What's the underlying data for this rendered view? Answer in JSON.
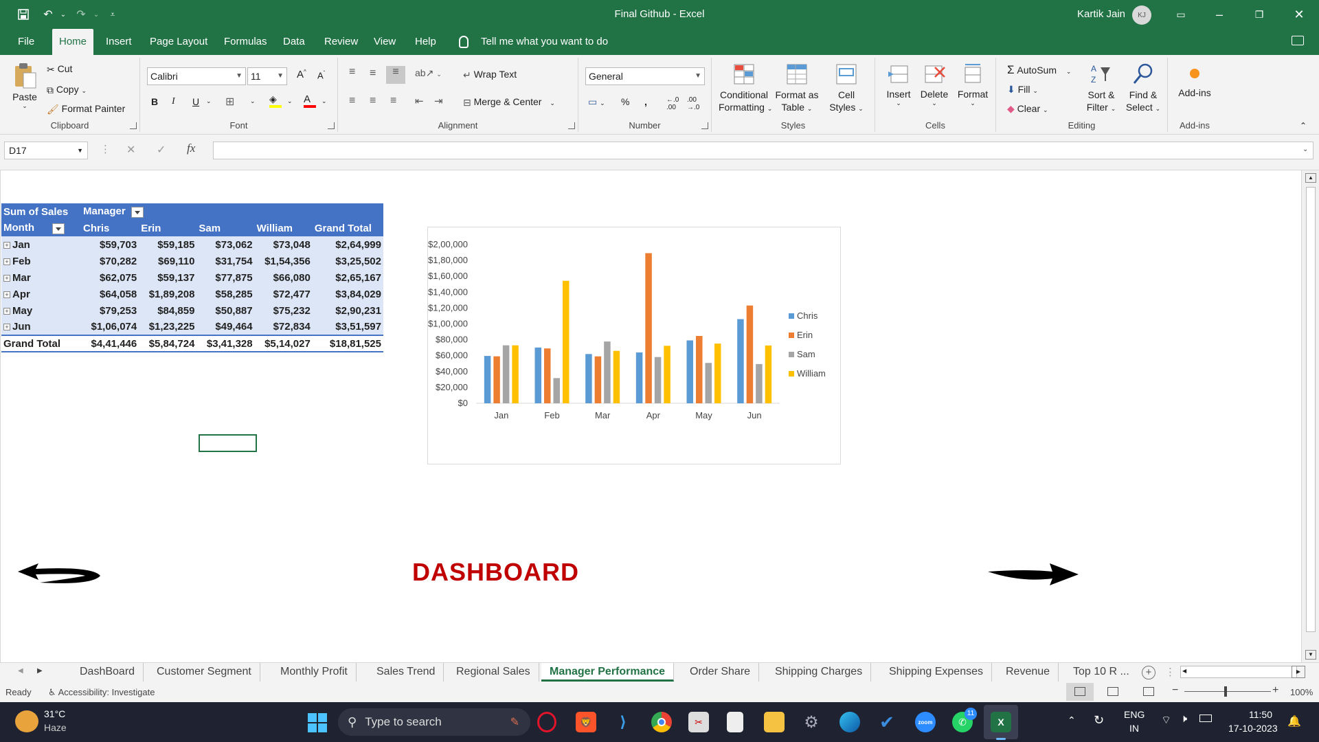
{
  "titlebar": {
    "title": "Final Github  -  Excel",
    "user": "Kartik Jain",
    "initials": "KJ"
  },
  "menu": {
    "tabs": [
      "File",
      "Home",
      "Insert",
      "Page Layout",
      "Formulas",
      "Data",
      "Review",
      "View",
      "Help"
    ],
    "active": "Home",
    "tell_me": "Tell me what you want to do"
  },
  "ribbon": {
    "clipboard": {
      "paste": "Paste",
      "cut": "Cut",
      "copy": "Copy",
      "format_painter": "Format Painter",
      "label": "Clipboard"
    },
    "font": {
      "name": "Calibri",
      "size": "11",
      "label": "Font"
    },
    "alignment": {
      "wrap_text": "Wrap Text",
      "merge_center": "Merge & Center",
      "label": "Alignment"
    },
    "number": {
      "format": "General",
      "label": "Number"
    },
    "styles": {
      "conditional": "Conditional",
      "conditional2": "Formatting",
      "format_as": "Format as",
      "format_as2": "Table",
      "cell": "Cell",
      "cell2": "Styles",
      "label": "Styles"
    },
    "cells": {
      "insert": "Insert",
      "delete": "Delete",
      "format": "Format",
      "label": "Cells"
    },
    "editing": {
      "autosum": "AutoSum",
      "fill": "Fill",
      "clear": "Clear",
      "sort": "Sort &",
      "sort2": "Filter",
      "find": "Find &",
      "find2": "Select",
      "label": "Editing"
    },
    "addins": {
      "addins": "Add-ins",
      "label": "Add-ins"
    }
  },
  "formula_bar": {
    "name_box": "D17",
    "fx": "fx",
    "content": ""
  },
  "pivot": {
    "header1": [
      "Sum of Sales",
      "Manager"
    ],
    "header2": [
      "Month",
      "Chris",
      "Erin",
      "Sam",
      "William",
      "Grand Total"
    ],
    "rows": [
      [
        "Jan",
        "$59,703",
        "$59,185",
        "$73,062",
        "$73,048",
        "$2,64,999"
      ],
      [
        "Feb",
        "$70,282",
        "$69,110",
        "$31,754",
        "$1,54,356",
        "$3,25,502"
      ],
      [
        "Mar",
        "$62,075",
        "$59,137",
        "$77,875",
        "$66,080",
        "$2,65,167"
      ],
      [
        "Apr",
        "$64,058",
        "$1,89,208",
        "$58,285",
        "$72,477",
        "$3,84,029"
      ],
      [
        "May",
        "$79,253",
        "$84,859",
        "$50,887",
        "$75,232",
        "$2,90,231"
      ],
      [
        "Jun",
        "$1,06,074",
        "$1,23,225",
        "$49,464",
        "$72,834",
        "$3,51,597"
      ]
    ],
    "total": [
      "Grand Total",
      "$4,41,446",
      "$5,84,724",
      "$3,41,328",
      "$5,14,027",
      "$18,81,525"
    ]
  },
  "chart_data": {
    "type": "bar",
    "categories": [
      "Jan",
      "Feb",
      "Mar",
      "Apr",
      "May",
      "Jun"
    ],
    "series": [
      {
        "name": "Chris",
        "color": "#5b9bd5",
        "values": [
          59703,
          70282,
          62075,
          64058,
          79253,
          106074
        ]
      },
      {
        "name": "Erin",
        "color": "#ed7d31",
        "values": [
          59185,
          69110,
          59137,
          189208,
          84859,
          123225
        ]
      },
      {
        "name": "Sam",
        "color": "#a5a5a5",
        "values": [
          73062,
          31754,
          77875,
          58285,
          50887,
          49464
        ]
      },
      {
        "name": "William",
        "color": "#ffc000",
        "values": [
          73048,
          154356,
          66080,
          72477,
          75232,
          72834
        ]
      }
    ],
    "ylim": [
      0,
      200000
    ],
    "yticks": [
      0,
      20000,
      40000,
      60000,
      80000,
      100000,
      120000,
      140000,
      160000,
      180000,
      200000
    ],
    "ytick_labels": [
      "$0",
      "$20,000",
      "$40,000",
      "$60,000",
      "$80,000",
      "$1,00,000",
      "$1,20,000",
      "$1,40,000",
      "$1,60,000",
      "$1,80,000",
      "$2,00,000"
    ],
    "legend_position": "right",
    "grid": false
  },
  "dashboard_label": "DASHBOARD",
  "sheets": [
    "DashBoard",
    "Customer Segment",
    "Monthly Profit",
    "Sales Trend",
    "Regional Sales",
    "Manager Performance",
    "Order Share",
    "Shipping Charges",
    "Shipping Expenses",
    "Revenue",
    "Top 10 R ..."
  ],
  "active_sheet": "Manager Performance",
  "status": {
    "ready": "Ready",
    "accessibility": "Accessibility: Investigate",
    "zoom": "100%"
  },
  "taskbar": {
    "weather_temp": "31°C",
    "weather_desc": "Haze",
    "search_placeholder": "Type to search",
    "lang1": "ENG",
    "lang2": "IN",
    "time": "11:50",
    "date": "17-10-2023",
    "whatsapp_badge": "11",
    "zoom_label": "zoom"
  }
}
